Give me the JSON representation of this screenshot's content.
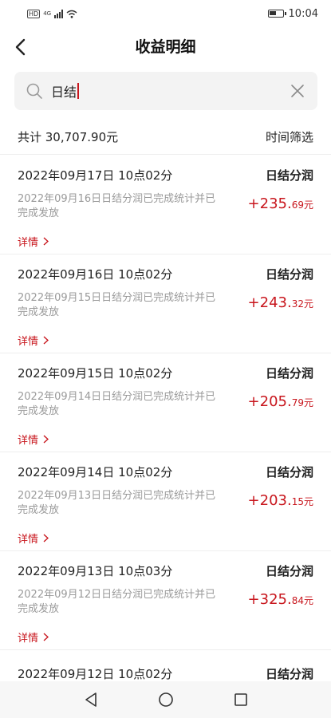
{
  "status_bar": {
    "network_badge": "HD",
    "network_type": "4G",
    "time": "10:04"
  },
  "header": {
    "title": "收益明细"
  },
  "search": {
    "value": "日结"
  },
  "summary": {
    "total": "共计 30,707.90元",
    "filter_label": "时间筛选"
  },
  "records": [
    {
      "datetime": "2022年09月17日 10点02分",
      "type": "日结分润",
      "desc": "2022年09月16日日结分润已完成统计并已完成发放",
      "amount_int": "+235.",
      "amount_dec": "69元",
      "detail": "详情"
    },
    {
      "datetime": "2022年09月16日 10点02分",
      "type": "日结分润",
      "desc": "2022年09月15日日结分润已完成统计并已完成发放",
      "amount_int": "+243.",
      "amount_dec": "32元",
      "detail": "详情"
    },
    {
      "datetime": "2022年09月15日 10点02分",
      "type": "日结分润",
      "desc": "2022年09月14日日结分润已完成统计并已完成发放",
      "amount_int": "+205.",
      "amount_dec": "79元",
      "detail": "详情"
    },
    {
      "datetime": "2022年09月14日 10点02分",
      "type": "日结分润",
      "desc": "2022年09月13日日结分润已完成统计并已完成发放",
      "amount_int": "+203.",
      "amount_dec": "15元",
      "detail": "详情"
    },
    {
      "datetime": "2022年09月13日 10点03分",
      "type": "日结分润",
      "desc": "2022年09月12日日结分润已完成统计并已完成发放",
      "amount_int": "+325.",
      "amount_dec": "84元",
      "detail": "详情"
    },
    {
      "datetime": "2022年09月12日 10点02分",
      "type": "日结分润"
    }
  ],
  "colors": {
    "accent": "#c8161d",
    "muted_text": "#9a9a9a",
    "search_bg": "#f3f3f3"
  }
}
